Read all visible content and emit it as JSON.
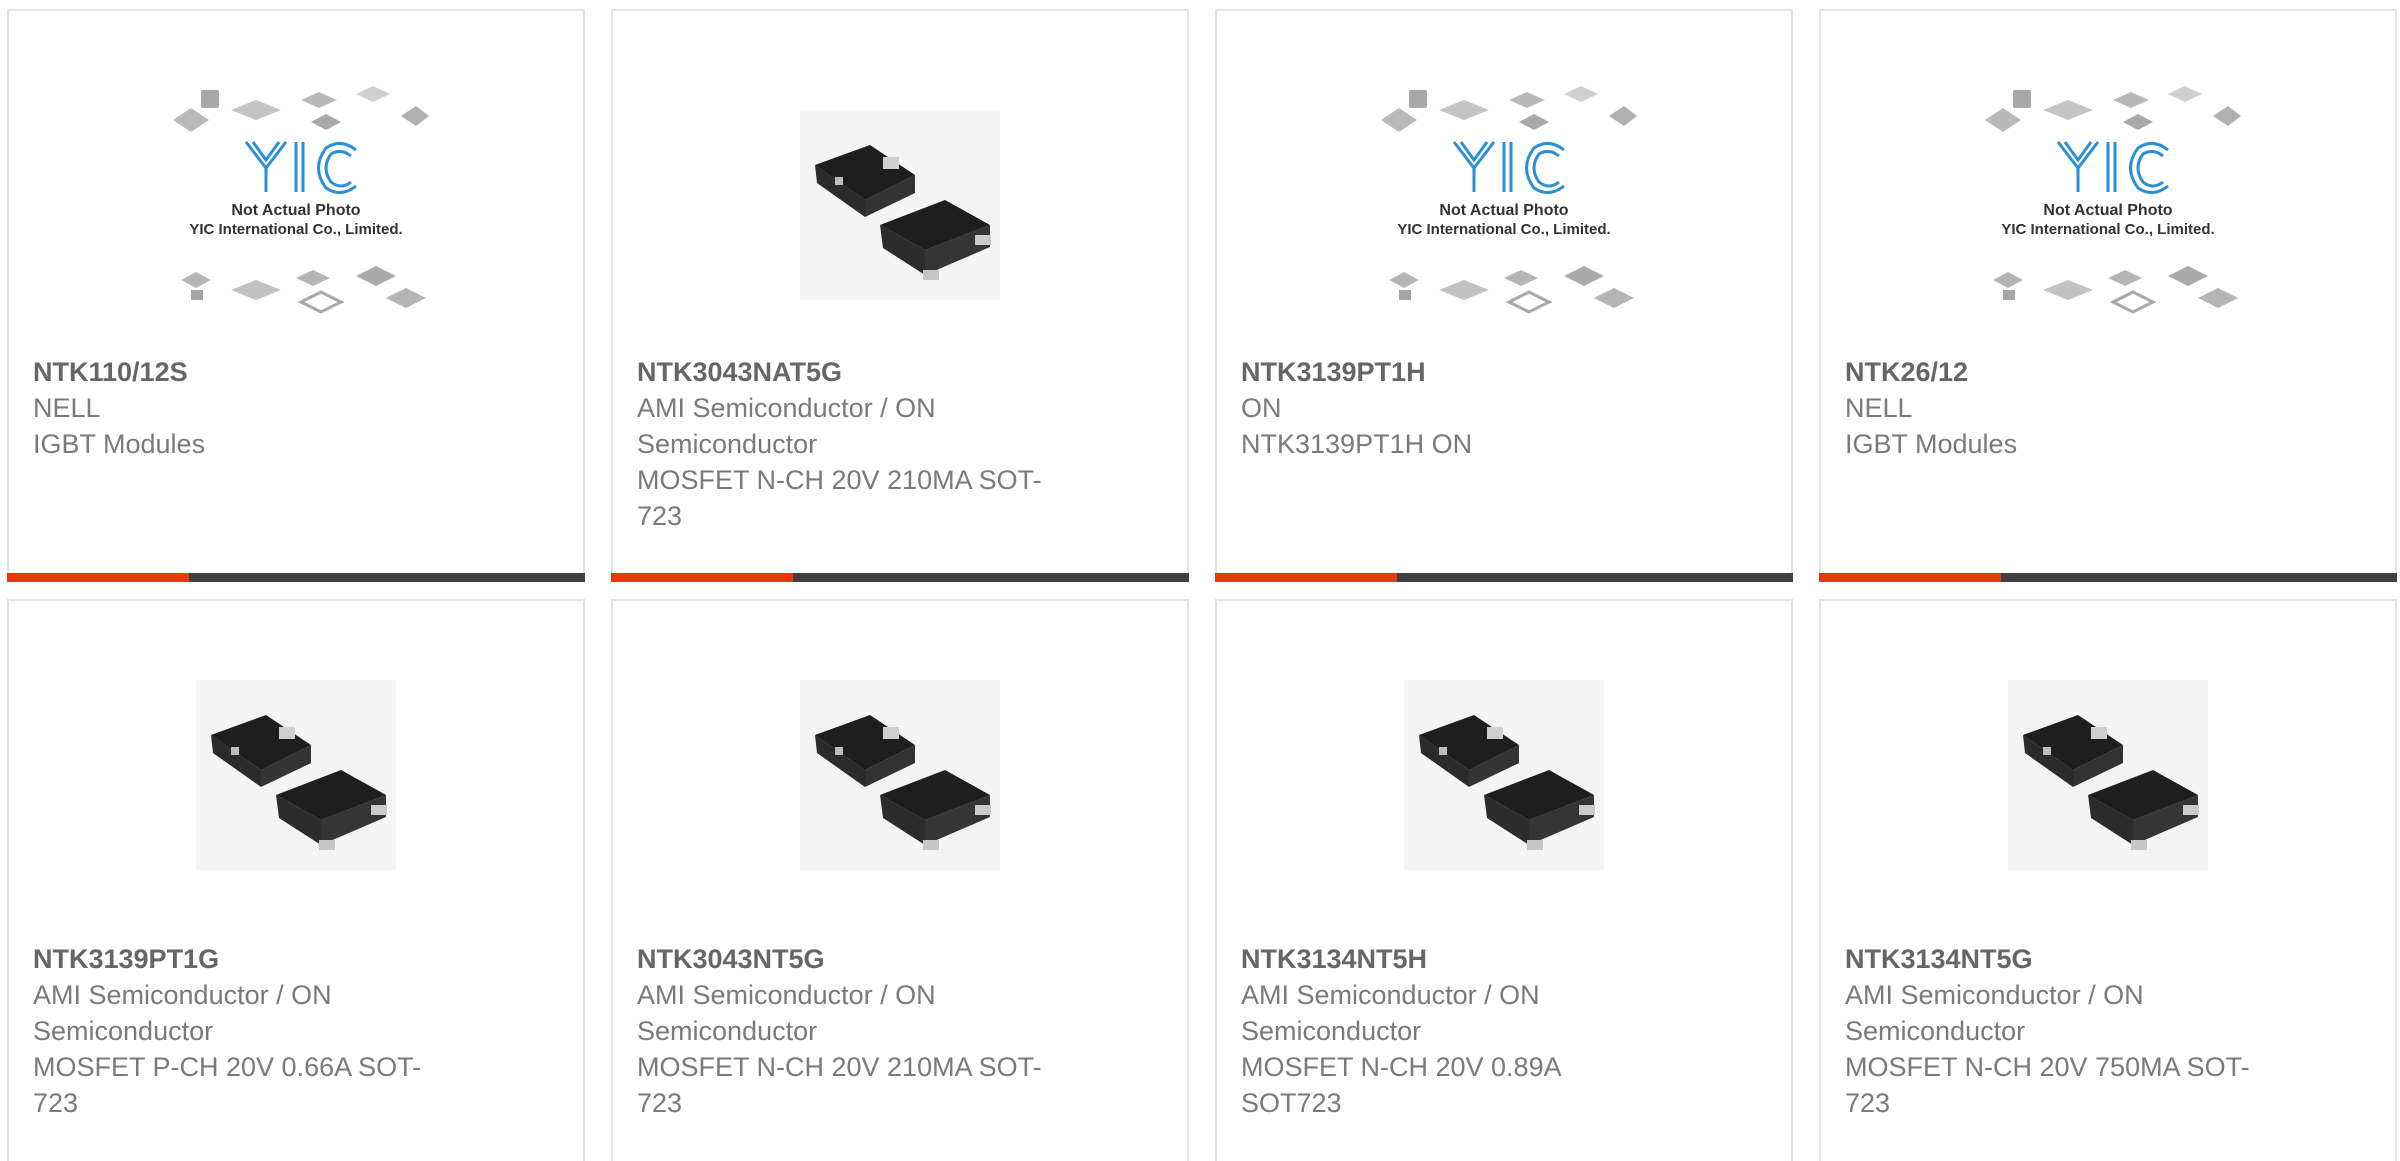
{
  "colors": {
    "accent": "#e8380d",
    "bar": "#404040",
    "border": "#e2e2e2",
    "text": "#7a7a7a",
    "title": "#666666",
    "logo": "#2a8fd6"
  },
  "placeholder": {
    "line1": "Not Actual Photo",
    "line2": "YIC International Co., Limited.",
    "logo_text": "YIC"
  },
  "products": [
    {
      "part": "NTK110/12S",
      "maker": "NELL",
      "desc": "IGBT Modules",
      "image": "placeholder-icon",
      "accent_bar": true
    },
    {
      "part": "NTK3043NAT5G",
      "maker": "AMI Semiconductor / ON Semiconductor",
      "desc": "MOSFET N-CH 20V 210MA SOT-723",
      "image": "sot723-chip-icon",
      "accent_bar": true
    },
    {
      "part": "NTK3139PT1H",
      "maker": "ON",
      "desc": "NTK3139PT1H ON",
      "image": "placeholder-icon",
      "accent_bar": true
    },
    {
      "part": "NTK26/12",
      "maker": "NELL",
      "desc": "IGBT Modules",
      "image": "placeholder-icon",
      "accent_bar": true
    },
    {
      "part": "NTK3139PT1G",
      "maker": "AMI Semiconductor / ON Semiconductor",
      "desc": "MOSFET P-CH 20V 0.66A SOT-723",
      "image": "sot723-chip-icon",
      "accent_bar": false
    },
    {
      "part": "NTK3043NT5G",
      "maker": "AMI Semiconductor / ON Semiconductor",
      "desc": "MOSFET N-CH 20V 210MA SOT-723",
      "image": "sot723-chip-icon",
      "accent_bar": false
    },
    {
      "part": "NTK3134NT5H",
      "maker": "AMI Semiconductor / ON Semiconductor",
      "desc": "MOSFET N-CH 20V 0.89A SOT723",
      "image": "sot723-chip-icon",
      "accent_bar": false
    },
    {
      "part": "NTK3134NT5G",
      "maker": "AMI Semiconductor / ON Semiconductor",
      "desc": "MOSFET N-CH 20V 750MA SOT-723",
      "image": "sot723-chip-icon",
      "accent_bar": false
    }
  ]
}
